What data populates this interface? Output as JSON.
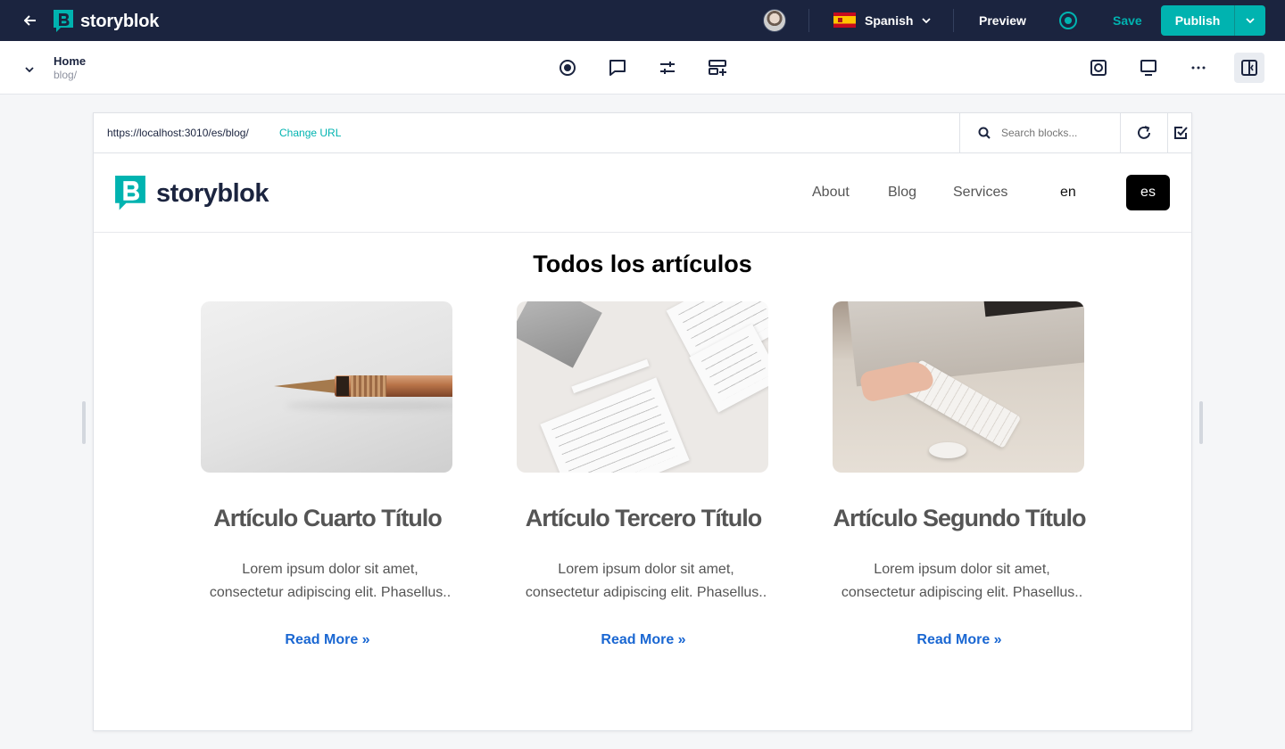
{
  "topbar": {
    "brand": "storyblok",
    "language": "Spanish",
    "preview_label": "Preview",
    "save_label": "Save",
    "publish_label": "Publish",
    "accent_color": "#00b3b0",
    "bg_color": "#1b243f"
  },
  "toolbar": {
    "page_title": "Home",
    "page_slug": "blog/",
    "icons": [
      "target-icon",
      "comment-icon",
      "settings-sliders-icon",
      "add-block-icon",
      "screenshot-icon",
      "desktop-icon",
      "more-icon",
      "panel-toggle-icon"
    ]
  },
  "urlbar": {
    "url": "https://localhost:3010/es/blog/",
    "change_url_label": "Change URL",
    "search_placeholder": "Search blocks..."
  },
  "site": {
    "brand": "storyblok",
    "nav": [
      "About",
      "Blog",
      "Services"
    ],
    "lang_en": "en",
    "lang_es": "es",
    "section_title": "Todos los artículos",
    "articles": [
      {
        "title": "Artículo Cuarto Título",
        "excerpt": "Lorem ipsum dolor sit amet, consectetur adipiscing elit. Phasellus..",
        "link": "Read More »"
      },
      {
        "title": "Artículo Tercero Título",
        "excerpt": "Lorem ipsum dolor sit amet, consectetur adipiscing elit. Phasellus..",
        "link": "Read More »"
      },
      {
        "title": "Artículo Segundo Título",
        "excerpt": "Lorem ipsum dolor sit amet, consectetur adipiscing elit. Phasellus..",
        "link": "Read More »"
      }
    ]
  }
}
